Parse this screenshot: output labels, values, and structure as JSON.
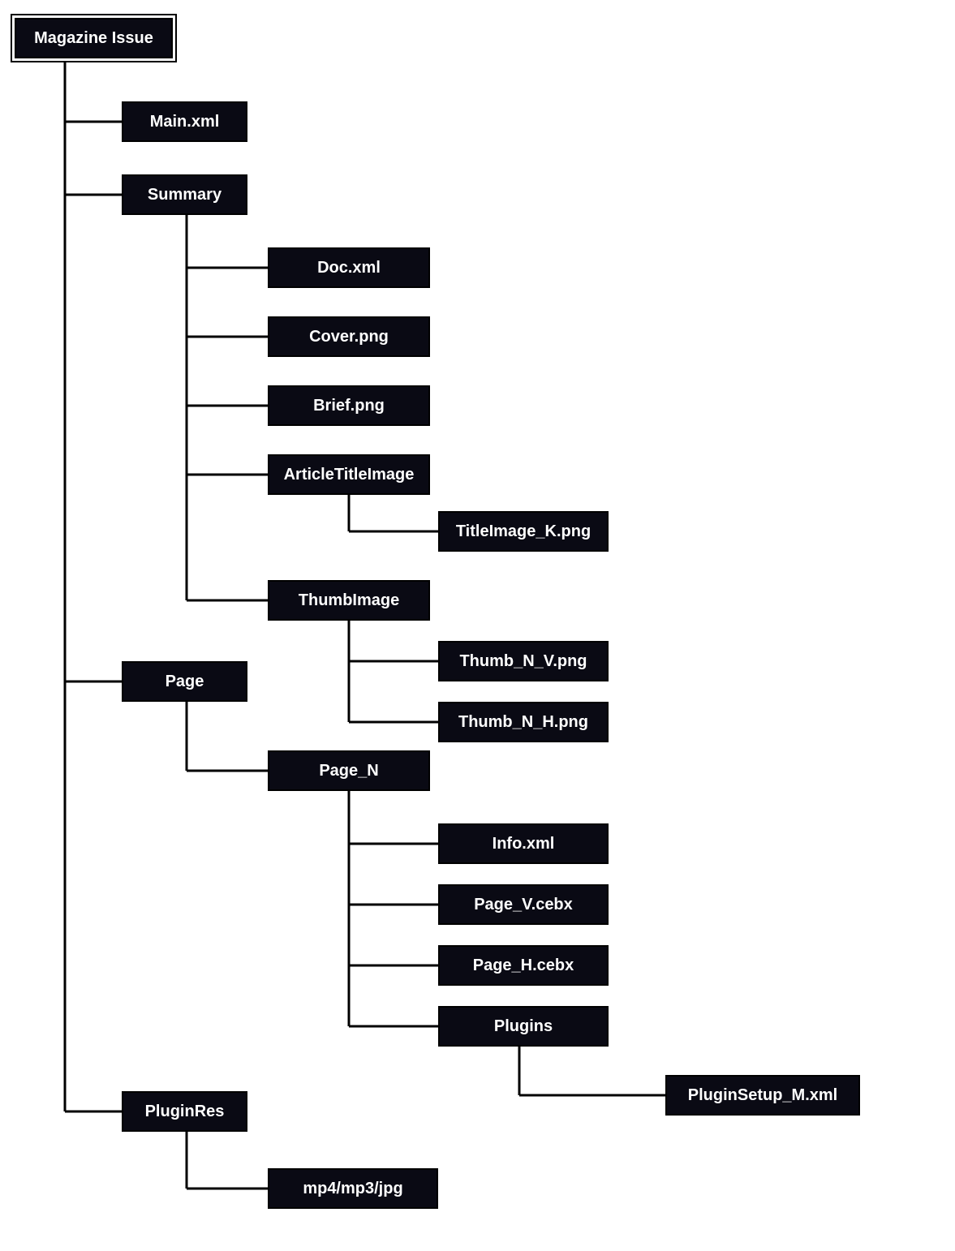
{
  "nodes": {
    "root": "Magazine Issue",
    "main_xml": "Main.xml",
    "summary": "Summary",
    "doc_xml": "Doc.xml",
    "cover_png": "Cover.png",
    "brief_png": "Brief.png",
    "article_title_image": "ArticleTitleImage",
    "title_image_k": "TitleImage_K.png",
    "thumb_image": "ThumbImage",
    "thumb_n_v": "Thumb_N_V.png",
    "thumb_n_h": "Thumb_N_H.png",
    "page": "Page",
    "page_n": "Page_N",
    "info_xml": "Info.xml",
    "page_v_cebx": "Page_V.cebx",
    "page_h_cebx": "Page_H.cebx",
    "plugins": "Plugins",
    "plugin_setup_m": "PluginSetup_M.xml",
    "plugin_res": "PluginRes",
    "mp4_mp3_jpg": "mp4/mp3/jpg"
  }
}
